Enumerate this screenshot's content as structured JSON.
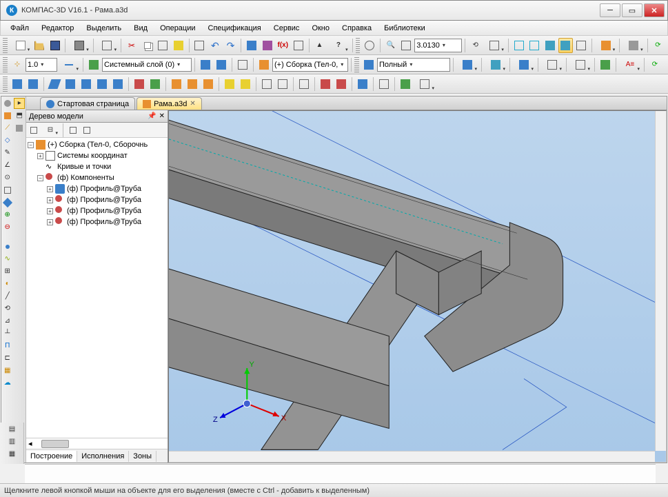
{
  "title": "КОМПАС-3D V16.1 - Рама.a3d",
  "menu": [
    "Файл",
    "Редактор",
    "Выделить",
    "Вид",
    "Операции",
    "Спецификация",
    "Сервис",
    "Окно",
    "Справка",
    "Библиотеки"
  ],
  "toolbar1": {
    "zoom_value": "3.0130"
  },
  "toolbar2": {
    "linewidth": "1.0",
    "layer": "Системный слой (0)",
    "assembly": "(+) Сборка (Тел-0,",
    "display_mode": "Полный"
  },
  "tabs": [
    {
      "label": "Стартовая страница",
      "icon": "blue",
      "active": false,
      "closable": false
    },
    {
      "label": "Рама.a3d",
      "icon": "orange",
      "active": true,
      "closable": true
    }
  ],
  "tree": {
    "title": "Дерево модели",
    "footer_tabs": [
      "Построение",
      "Исполнения",
      "Зоны"
    ],
    "root": {
      "label": "(+) Сборка (Тел-0, Сборочнь",
      "icon": "assembly-icon"
    },
    "children": [
      {
        "exp": "+",
        "label": "Системы координат",
        "icon": "coord-icon"
      },
      {
        "exp": " ",
        "label": "Кривые и точки",
        "icon": "curve-icon"
      },
      {
        "exp": "-",
        "label": "(ф) Компоненты",
        "icon": "comp-icon"
      }
    ],
    "components": [
      {
        "label": "(ф) Профиль@Труба"
      },
      {
        "label": "(ф) Профиль@Труба"
      },
      {
        "label": "(ф) Профиль@Труба"
      },
      {
        "label": "(ф) Профиль@Труба"
      }
    ]
  },
  "status": "Щелкните левой кнопкой мыши на объекте для его выделения (вместе с Ctrl - добавить к выделенным)"
}
